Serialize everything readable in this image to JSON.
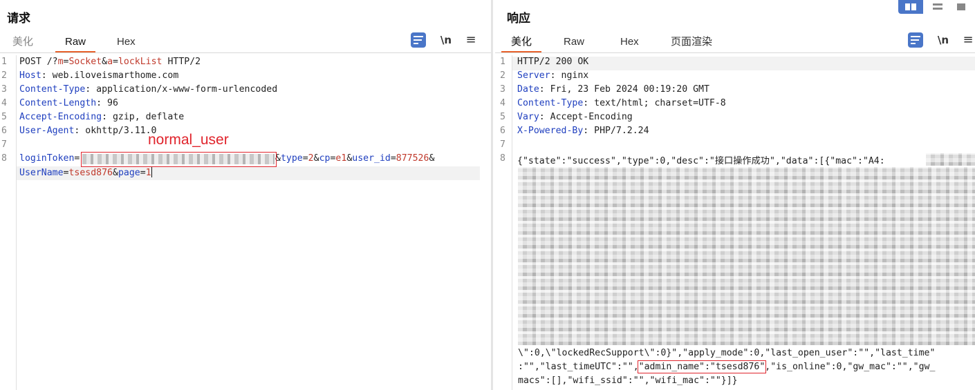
{
  "request": {
    "title": "请求",
    "tabs": [
      "美化",
      "Raw",
      "Hex"
    ],
    "active_tab": "Raw",
    "newline_label": "\\n",
    "menu_label": "≡",
    "lines": [
      {
        "n": "1",
        "parts": [
          [
            "t",
            "POST /?"
          ],
          [
            "par",
            "m"
          ],
          [
            "t",
            "="
          ],
          [
            "par",
            "Socket"
          ],
          [
            "t",
            "&"
          ],
          [
            "par",
            "a"
          ],
          [
            "t",
            "="
          ],
          [
            "par",
            "lockList"
          ],
          [
            "t",
            " HTTP/2"
          ]
        ]
      },
      {
        "n": "2",
        "parts": [
          [
            "key",
            "Host"
          ],
          [
            "t",
            ": web.iloveismarthome.com"
          ]
        ]
      },
      {
        "n": "3",
        "parts": [
          [
            "key",
            "Content-Type"
          ],
          [
            "t",
            ": application/x-www-form-urlencoded"
          ]
        ]
      },
      {
        "n": "4",
        "parts": [
          [
            "key",
            "Content-Length"
          ],
          [
            "t",
            ": 96"
          ]
        ]
      },
      {
        "n": "5",
        "parts": [
          [
            "key",
            "Accept-Encoding"
          ],
          [
            "t",
            ": gzip, deflate"
          ]
        ]
      },
      {
        "n": "6",
        "parts": [
          [
            "key",
            "User-Agent"
          ],
          [
            "t",
            ": okhttp/3.11.0"
          ]
        ]
      },
      {
        "n": "7",
        "parts": []
      },
      {
        "n": "8",
        "parts": [
          [
            "key",
            "loginToken"
          ],
          [
            "t",
            "="
          ]
        ]
      },
      {
        "n": "",
        "parts": [
          [
            "key",
            "UserName"
          ],
          [
            "t",
            "="
          ],
          [
            "par",
            "tsesd876"
          ],
          [
            "t",
            "&"
          ],
          [
            "key",
            "page"
          ],
          [
            "t",
            "="
          ],
          [
            "par",
            "1"
          ]
        ]
      }
    ],
    "line8_tail": [
      [
        "t",
        "&"
      ],
      [
        "key",
        "type"
      ],
      [
        "t",
        "="
      ],
      [
        "par",
        "2"
      ],
      [
        "t",
        "&"
      ],
      [
        "key",
        "cp"
      ],
      [
        "t",
        "="
      ],
      [
        "par",
        "e1"
      ],
      [
        "t",
        "&"
      ],
      [
        "key",
        "user_id"
      ],
      [
        "t",
        "="
      ],
      [
        "par",
        "877526"
      ],
      [
        "t",
        "&"
      ]
    ],
    "annotation": "normal_user"
  },
  "response": {
    "title": "响应",
    "tabs": [
      "美化",
      "Raw",
      "Hex",
      "页面渲染"
    ],
    "active_tab": "美化",
    "newline_label": "\\n",
    "menu_label": "≡",
    "lines": [
      {
        "n": "1",
        "parts": [
          [
            "t",
            "HTTP/2 200 OK"
          ]
        ]
      },
      {
        "n": "2",
        "parts": [
          [
            "key",
            "Server"
          ],
          [
            "t",
            ": nginx"
          ]
        ]
      },
      {
        "n": "3",
        "parts": [
          [
            "key",
            "Date"
          ],
          [
            "t",
            ": Fri, 23 Feb 2024 00:19:20 GMT"
          ]
        ]
      },
      {
        "n": "4",
        "parts": [
          [
            "key",
            "Content-Type"
          ],
          [
            "t",
            ": text/html; charset=UTF-8"
          ]
        ]
      },
      {
        "n": "5",
        "parts": [
          [
            "key",
            "Vary"
          ],
          [
            "t",
            ": Accept-Encoding"
          ]
        ]
      },
      {
        "n": "6",
        "parts": [
          [
            "key",
            "X-Powered-By"
          ],
          [
            "t",
            ": PHP/7.2.24"
          ]
        ]
      },
      {
        "n": "7",
        "parts": []
      },
      {
        "n": "8",
        "parts": [
          [
            "t",
            "{\"state\":\"success\",\"type\":0,\"desc\":\"接口操作成功\",\"data\":[{\"mac\":\"A4:"
          ]
        ]
      }
    ],
    "tail_lines": [
      "\\\":0,\\\"lockedRecSupport\\\":0}\",\"apply_mode\":0,\"last_open_user\":\"\",\"last_time\"",
      ":\"\",\"last_timeUTC\":\"\",",
      "macs\":[],\"wifi_ssid\":\"\",\"wifi_mac\":\"\"}]}"
    ],
    "admin_field": "\"admin_name\":\"tsesd876\"",
    "after_admin": ",\"is_online\":0,\"gw_mac\":\"\",\"gw_"
  }
}
